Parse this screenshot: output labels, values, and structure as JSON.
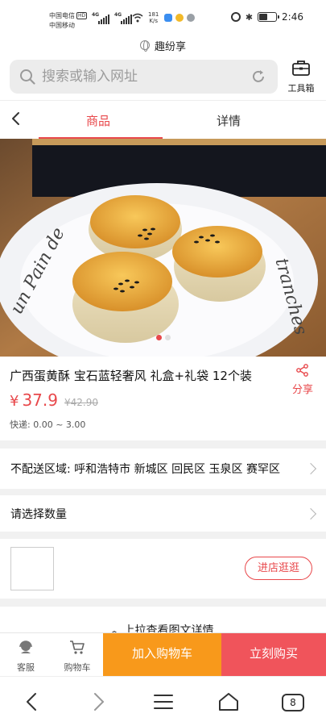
{
  "status": {
    "carrier1": "中国电信",
    "carrier1_badge": "HD",
    "carrier2": "中国移动",
    "net1": "4G",
    "net2": "4G",
    "speed_value": "181",
    "speed_unit": "K/s",
    "bluetooth": "✱",
    "time": "2:46",
    "battery_level": 0.5
  },
  "site": {
    "title": "趣纷享"
  },
  "search": {
    "placeholder": "搜索或输入网址",
    "toolbox_label": "工具箱"
  },
  "tabs": {
    "goods": "商品",
    "detail": "详情"
  },
  "product": {
    "title": "广西蛋黄酥 宝石蓝轻奢风 礼盒+礼袋 12个装",
    "currency": "¥",
    "price": "37.9",
    "old_price": "¥42.90",
    "shipping": "快递:  0.00 ~ 3.00",
    "share_label": "分享",
    "plate_text_1": "un Pain de",
    "plate_text_2": "tranches",
    "carousel_total": 2,
    "carousel_active": 1
  },
  "rows": {
    "no_delivery": "不配送区域: 呼和浩特市 新城区 回民区 玉泉区 赛罕区",
    "choose_qty": "请选择数量"
  },
  "shop": {
    "enter_label": "进店逛逛"
  },
  "pull_hint": "上拉查看图文详情",
  "actions": {
    "service": "客服",
    "cart": "购物车",
    "add_to_cart": "加入购物车",
    "buy_now": "立刻购买"
  },
  "browser": {
    "tab_count": "8"
  },
  "colors": {
    "accent": "#e8484b",
    "cart_button": "#f8991b",
    "buy_button": "#f0545b"
  }
}
